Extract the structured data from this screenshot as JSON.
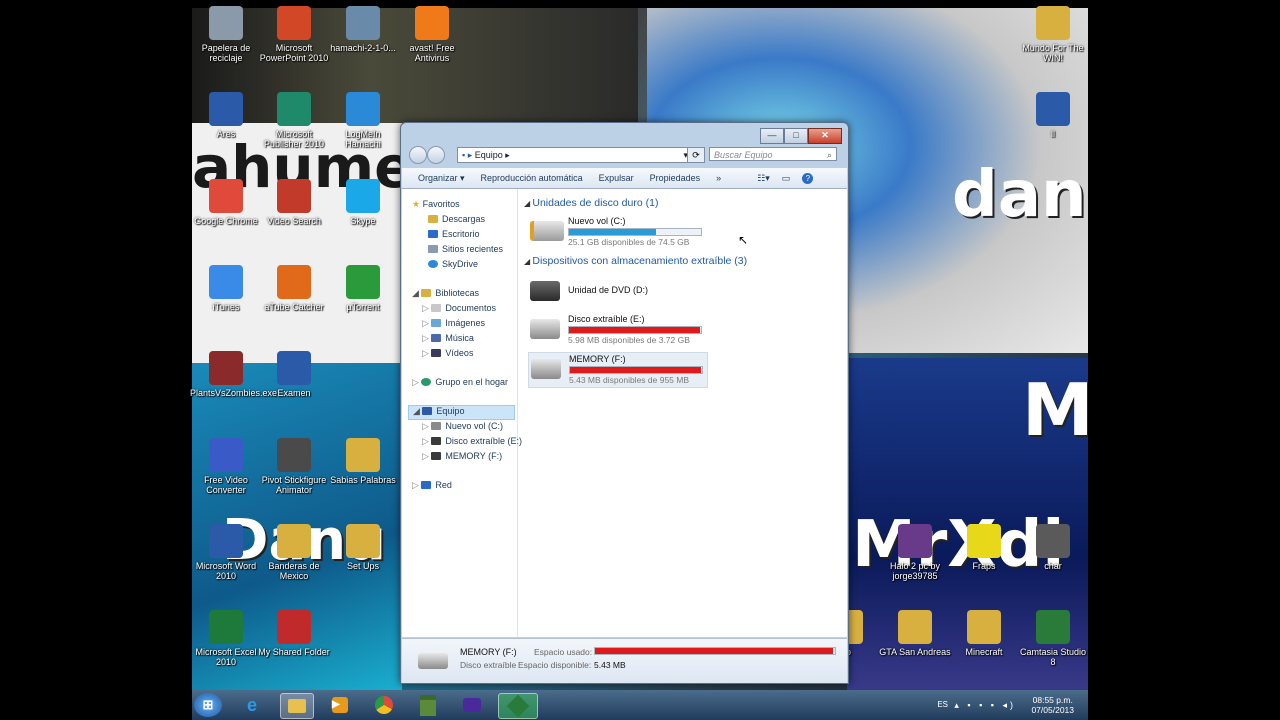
{
  "desktop_icons": [
    {
      "label": "Papelera de reciclaje",
      "icon": "recycle-bin-icon",
      "color": "#8a9aa8"
    },
    {
      "label": "Microsoft PowerPoint 2010",
      "icon": "powerpoint-icon",
      "color": "#d24726"
    },
    {
      "label": "hamachi-2-1-0...",
      "icon": "hamachi-installer-icon",
      "color": "#6a8aaa"
    },
    {
      "label": "avast! Free Antivirus",
      "icon": "avast-icon",
      "color": "#f07a1a"
    },
    {
      "label": "Ares",
      "icon": "ares-icon",
      "color": "#2a5aa8"
    },
    {
      "label": "Microsoft Publisher 2010",
      "icon": "publisher-icon",
      "color": "#1e8a6a"
    },
    {
      "label": "LogMeIn Hamachi",
      "icon": "hamachi-icon",
      "color": "#2a8ad8"
    },
    {
      "label": "Google Chrome",
      "icon": "chrome-icon",
      "color": "#e04a3a"
    },
    {
      "label": "Video Search",
      "icon": "video-search-icon",
      "color": "#c23a2a"
    },
    {
      "label": "Skype",
      "icon": "skype-icon",
      "color": "#1aa8e8"
    },
    {
      "label": "iTunes",
      "icon": "itunes-icon",
      "color": "#3a8ae8"
    },
    {
      "label": "aTube Catcher",
      "icon": "atube-catcher-icon",
      "color": "#e06a1a"
    },
    {
      "label": "µTorrent",
      "icon": "utorrent-icon",
      "color": "#2a9a3a"
    },
    {
      "label": "PlantsVsZombies.exe",
      "icon": "plants-vs-zombies-icon",
      "color": "#8a2a2a"
    },
    {
      "label": "Examen",
      "icon": "word-document-icon",
      "color": "#2a5aa8"
    },
    {
      "label": "Free Video Converter",
      "icon": "video-converter-icon",
      "color": "#3a5ac8"
    },
    {
      "label": "Pivot Stickfigure Animator",
      "icon": "pivot-icon",
      "color": "#4a4a4a"
    },
    {
      "label": "Sabias Palabras",
      "icon": "folder-icon",
      "color": "#d8b040"
    },
    {
      "label": "Microsoft Word 2010",
      "icon": "word-icon",
      "color": "#2a5aa8"
    },
    {
      "label": "Banderas de Mexico",
      "icon": "folder-icon",
      "color": "#d8b040"
    },
    {
      "label": "Set Ups",
      "icon": "folder-icon",
      "color": "#d8b040"
    },
    {
      "label": "Microsoft Excel 2010",
      "icon": "excel-icon",
      "color": "#1e7a3a"
    },
    {
      "label": "My Shared Folder",
      "icon": "shared-folder-icon",
      "color": "#c02a2a"
    },
    {
      "label": "Mundo For The WIN!",
      "icon": "folder-icon",
      "color": "#d8b040"
    },
    {
      "label": "ll",
      "icon": "word-document-icon",
      "color": "#2a5aa8"
    },
    {
      "label": "Halo 2 pc by jorge39785",
      "icon": "winrar-icon",
      "color": "#6a3a8a"
    },
    {
      "label": "Fraps",
      "icon": "fraps-icon",
      "color": "#e8d81a"
    },
    {
      "label": "char",
      "icon": "app-icon",
      "color": "#5a5a5a"
    },
    {
      "label": "go",
      "icon": "folder-icon",
      "color": "#d8b040"
    },
    {
      "label": "GTA San Andreas",
      "icon": "folder-icon",
      "color": "#d8b040"
    },
    {
      "label": "Minecraft",
      "icon": "folder-icon",
      "color": "#d8b040"
    },
    {
      "label": "Camtasia Studio 8",
      "icon": "camtasia-icon",
      "color": "#2a7a3a"
    }
  ],
  "wallpaper_text": [
    "ahume",
    "dani",
    "M",
    "MrXdi",
    "Danu"
  ],
  "window": {
    "controls": {
      "minimize": "—",
      "maximize": "□",
      "close": "✕"
    },
    "address": "Equipo",
    "search_placeholder": "Buscar Equipo",
    "toolbar": [
      "Organizar ▾",
      "Reproducción automática",
      "Expulsar",
      "Propiedades",
      "»"
    ],
    "nav": {
      "favorites": "Favoritos",
      "fav_items": [
        "Descargas",
        "Escritorio",
        "Sitios recientes",
        "SkyDrive"
      ],
      "libraries": "Bibliotecas",
      "lib_items": [
        "Documentos",
        "Imágenes",
        "Música",
        "Vídeos"
      ],
      "homegroup": "Grupo en el hogar",
      "computer": "Equipo",
      "comp_items": [
        "Nuevo vol (C:)",
        "Disco extraíble (E:)",
        "MEMORY (F:)"
      ],
      "network": "Red"
    },
    "sections": {
      "hdd": "Unidades de disco duro (1)",
      "removable": "Dispositivos con almacenamiento extraíble (3)"
    },
    "drives": [
      {
        "name": "Nuevo vol (C:)",
        "free": "25.1 GB disponibles de 74.5 GB",
        "used_fraction": 0.66,
        "bar_color": "#2a9ad8"
      },
      {
        "name": "Unidad de DVD (D:)",
        "free": "",
        "used_fraction": 0,
        "bar_color": ""
      },
      {
        "name": "Disco extraíble (E:)",
        "free": "5.98 MB disponibles de 3.72 GB",
        "used_fraction": 0.99,
        "bar_color": "#e01a1a"
      },
      {
        "name": "MEMORY (F:)",
        "free": "5.43 MB disponibles de 955 MB",
        "used_fraction": 0.99,
        "bar_color": "#e01a1a"
      }
    ],
    "status": {
      "name": "MEMORY (F:)",
      "type": "Disco extraíble",
      "used_label": "Espacio usado:",
      "free_label": "Espacio disponible:",
      "free_value": "5.43 MB",
      "used_fraction": 0.99
    }
  },
  "taskbar": {
    "apps": [
      "start-orb-icon",
      "internet-explorer-icon",
      "explorer-icon",
      "media-player-icon",
      "chrome-icon",
      "minecraft-icon",
      "game-icon",
      "camtasia-icon"
    ],
    "lang": "ES",
    "time": "08:55 p.m.",
    "date": "07/05/2013"
  }
}
